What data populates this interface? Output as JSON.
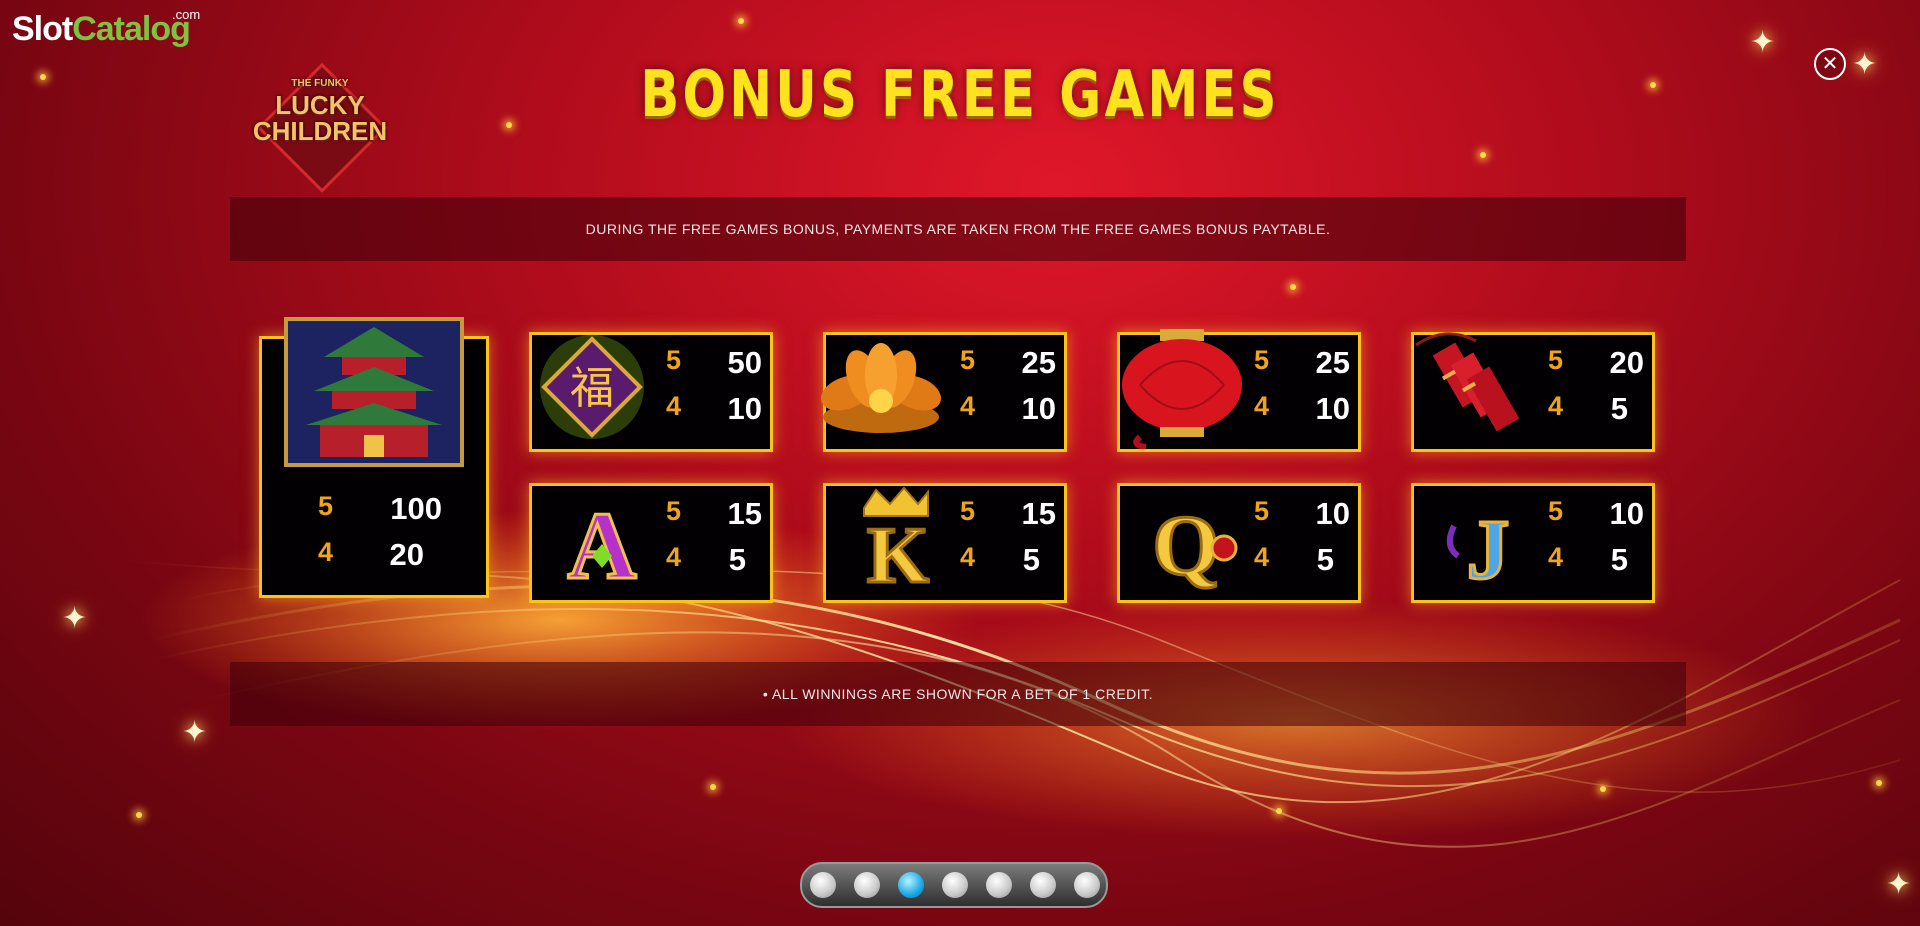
{
  "brand": {
    "part1": "Slot",
    "part2": "Catalog",
    "com": ".com"
  },
  "logo": {
    "line1": "THE FUNKY",
    "line2": "LUCKY",
    "line3": "CHILDREN"
  },
  "title": "BONUS FREE GAMES",
  "close_icon": "close-icon",
  "info_top": "DURING THE FREE GAMES BONUS, PAYMENTS ARE TAKEN FROM THE FREE GAMES BONUS PAYTABLE.",
  "info_bottom": "• ALL WINNINGS ARE SHOWN FOR A BET OF 1 CREDIT.",
  "symbols": {
    "pagoda": {
      "icon": "pagoda-icon",
      "p5": "100",
      "p4": "20"
    },
    "fu": {
      "icon": "fu-tile-icon",
      "glyph": "福",
      "p5": "50",
      "p4": "10"
    },
    "lotus": {
      "icon": "lotus-icon",
      "p5": "25",
      "p4": "10"
    },
    "lantern": {
      "icon": "lantern-icon",
      "p5": "25",
      "p4": "10"
    },
    "firecrackers": {
      "icon": "firecrackers-icon",
      "p5": "20",
      "p4": "5"
    },
    "ace": {
      "icon": "ace-icon",
      "glyph": "A",
      "p5": "15",
      "p4": "5"
    },
    "king": {
      "icon": "king-icon",
      "glyph": "K",
      "p5": "15",
      "p4": "5"
    },
    "queen": {
      "icon": "queen-icon",
      "glyph": "Q",
      "p5": "10",
      "p4": "5"
    },
    "jack": {
      "icon": "jack-icon",
      "glyph": "J",
      "p5": "10",
      "p4": "5"
    }
  },
  "count_labels": {
    "five": "5",
    "four": "4"
  },
  "pagination": {
    "pages": 7,
    "current": 3
  },
  "colors": {
    "accent": "#ffc21a",
    "title": "#ffe21e",
    "brand_green": "#7ec242",
    "active_dot": "#1aa8e6"
  }
}
